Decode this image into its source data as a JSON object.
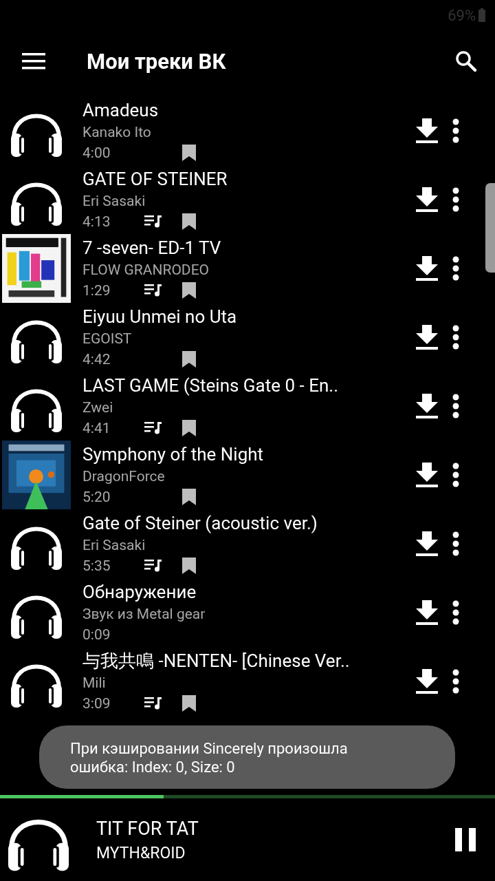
{
  "status_bar": {
    "battery": "69%"
  },
  "app_bar": {
    "title": "Мои треки ВК"
  },
  "tracks": [
    {
      "title": "Amadeus",
      "artist": "Kanako Ito",
      "duration": "4:00",
      "kind": "headphones",
      "lyrics": false,
      "bookmark": true
    },
    {
      "title": "GATE OF STEINER",
      "artist": "Eri Sasaki",
      "duration": "4:13",
      "kind": "headphones",
      "lyrics": true,
      "bookmark": true
    },
    {
      "title": "7 -seven- ED-1 TV",
      "artist": "FLOW GRANRODEO",
      "duration": "1:29",
      "kind": "picture",
      "lyrics": true,
      "bookmark": true
    },
    {
      "title": "Eiyuu Unmei no Uta",
      "artist": "EGOIST",
      "duration": "4:42",
      "kind": "headphones",
      "lyrics": false,
      "bookmark": true
    },
    {
      "title": "LAST GAME (Steins Gate 0 - En..",
      "artist": "Zwei",
      "duration": "4:41",
      "kind": "headphones",
      "lyrics": true,
      "bookmark": true
    },
    {
      "title": "Symphony of the Night",
      "artist": "DragonForce",
      "duration": "5:20",
      "kind": "picture",
      "lyrics": false,
      "bookmark": true
    },
    {
      "title": "Gate of Steiner (acoustic ver.)",
      "artist": "Eri Sasaki",
      "duration": "5:35",
      "kind": "headphones",
      "lyrics": true,
      "bookmark": true
    },
    {
      "title": "Обнаружение",
      "artist": "Звук из Metal gear",
      "duration": "0:09",
      "kind": "headphones",
      "lyrics": false,
      "bookmark": false
    },
    {
      "title": "与我共鳴 -NENTEN- [Chinese Ver..",
      "artist": "Mili",
      "duration": "3:09",
      "kind": "headphones",
      "lyrics": true,
      "bookmark": true
    }
  ],
  "toast": {
    "message": "При кэшировании Sincerely произошла ошибка: Index: 0, Size: 0"
  },
  "player": {
    "title": "TIT FOR TAT",
    "artist": "MYTH&ROID",
    "level": 0.33,
    "playing": true
  }
}
